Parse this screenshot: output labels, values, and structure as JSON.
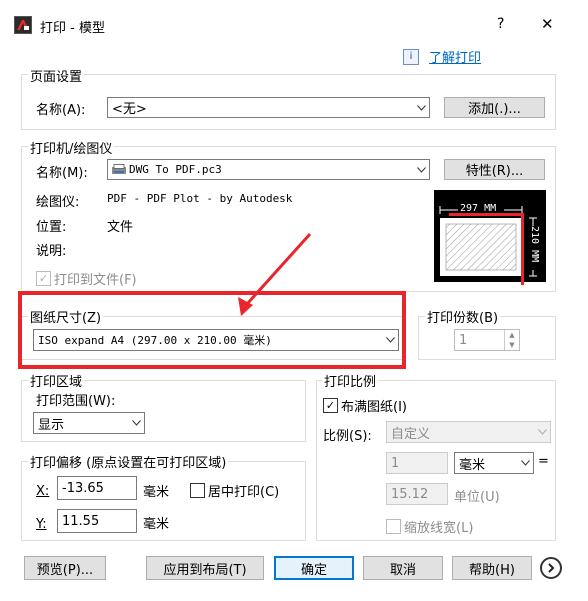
{
  "window": {
    "app_icon": "autocad-icon",
    "title": "打印 - 模型",
    "help_glyph": "?",
    "close_glyph": "✕"
  },
  "help_link": {
    "icon": "info-icon",
    "label": "了解打印"
  },
  "page_setup": {
    "title": "页面设置",
    "name_label": "名称(A):",
    "name_value": "<无>",
    "add_button": "添加(.)..."
  },
  "printer": {
    "title": "打印机/绘图仪",
    "name_label": "名称(M):",
    "name_value": "DWG To PDF.pc3",
    "properties_button": "特性(R)...",
    "plotter_label": "绘图仪:",
    "plotter_value": "PDF - PDF Plot - by Autodesk",
    "location_label": "位置:",
    "location_value": "文件",
    "description_label": "说明:",
    "plot_to_file_label": "打印到文件(F)",
    "plot_to_file_checked": true,
    "preview_width": "297 MM",
    "preview_height": "210 MM"
  },
  "paper_size": {
    "title": "图纸尺寸(Z)",
    "value": "ISO expand A4 (297.00 x 210.00 毫米)"
  },
  "copies": {
    "title": "打印份数(B)",
    "value": "1"
  },
  "plot_area": {
    "title": "打印区域",
    "range_label": "打印范围(W):",
    "range_value": "显示"
  },
  "plot_offset": {
    "title": "打印偏移 (原点设置在可打印区域)",
    "x_label": "X:",
    "x_value": "-13.65",
    "x_unit": "毫米",
    "center_label": "居中打印(C)",
    "center_checked": false,
    "y_label": "Y:",
    "y_value": "11.55",
    "y_unit": "毫米"
  },
  "plot_scale": {
    "title": "打印比例",
    "fit_label": "布满图纸(I)",
    "fit_checked": true,
    "scale_label": "比例(S):",
    "scale_value": "自定义",
    "num_value": "1",
    "unit_value": "毫米",
    "equals": "=",
    "den_value": "15.12",
    "den_unit": "单位(U)",
    "lineweights_label": "缩放线宽(L)",
    "lineweights_checked": false
  },
  "bottom": {
    "preview_button": "预览(P)...",
    "apply_button": "应用到布局(T)",
    "ok_button": "确定",
    "cancel_button": "取消",
    "help_button": "帮助(H)"
  },
  "colors": {
    "annotation_red": "#e8262b",
    "accent_blue": "#0078d7",
    "link_blue": "#0066cc"
  }
}
